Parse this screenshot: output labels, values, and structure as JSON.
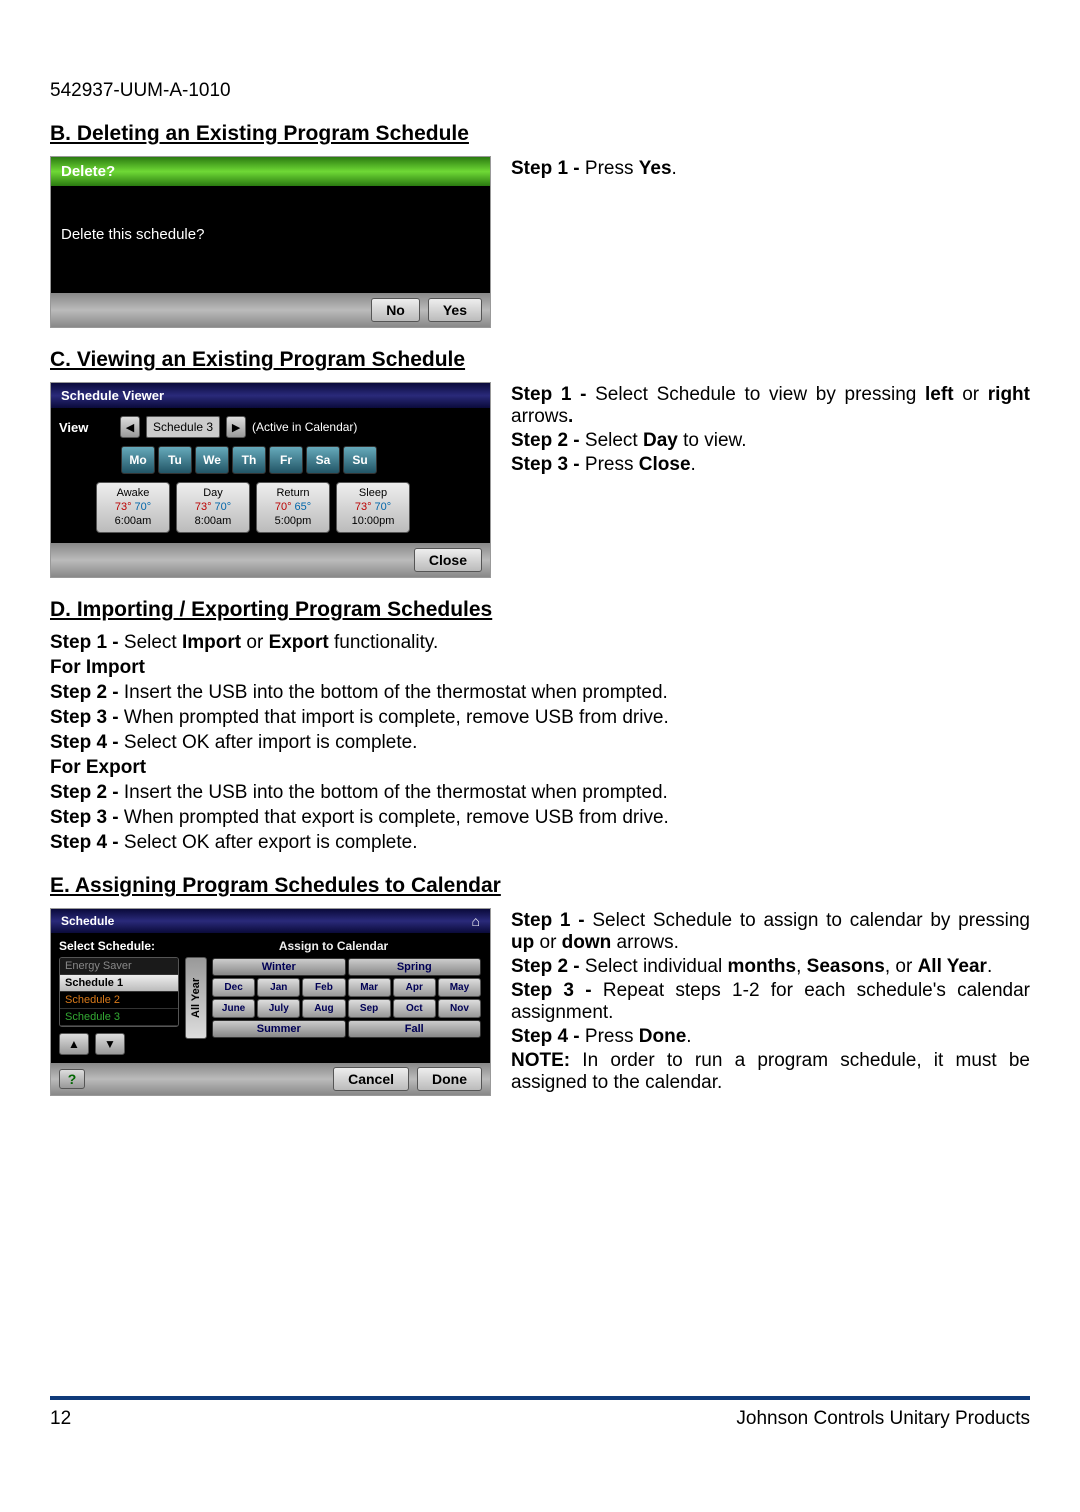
{
  "doc_id": "542937-UUM-A-1010",
  "sectionB": {
    "heading": "B. Deleting an Existing Program Schedule",
    "screen": {
      "title": "Delete?",
      "prompt": "Delete this schedule?",
      "no": "No",
      "yes": "Yes"
    },
    "step1_label": "Step 1 - ",
    "step1_text": "Press ",
    "step1_bold": "Yes",
    "step1_tail": "."
  },
  "sectionC": {
    "heading": "C. Viewing an Existing Program Schedule",
    "screen": {
      "title": "Schedule Viewer",
      "view": "View",
      "sched_name": "Schedule 3",
      "active": "(Active in Calendar)",
      "days": [
        "Mo",
        "Tu",
        "We",
        "Th",
        "Fr",
        "Sa",
        "Su"
      ],
      "periods": [
        {
          "name": "Awake",
          "h": "73°",
          "c": "70°",
          "time": "6:00am"
        },
        {
          "name": "Day",
          "h": "73°",
          "c": "70°",
          "time": "8:00am"
        },
        {
          "name": "Return",
          "h": "70°",
          "c": "65°",
          "time": "5:00pm"
        },
        {
          "name": "Sleep",
          "h": "73°",
          "c": "70°",
          "time": "10:00pm"
        }
      ],
      "close": "Close"
    },
    "step1a": "Step 1 - ",
    "step1b": "Select Schedule to view by pressing ",
    "step1c": "left",
    "step1d": " or ",
    "step1e": "right",
    "step1f": " arrows",
    "step1g": ".",
    "step2a": "Step 2 - ",
    "step2b": "Select ",
    "step2c": "Day",
    "step2d": " to view.",
    "step3a": "Step 3 - ",
    "step3b": "Press ",
    "step3c": "Close",
    "step3d": "."
  },
  "sectionD": {
    "heading": "D. Importing / Exporting Program Schedules",
    "s1a": "Step 1 - ",
    "s1b": "Select ",
    "s1c": "Import",
    "s1d": " or ",
    "s1e": "Export",
    "s1f": " functionality.",
    "imp": "For Import",
    "is2a": "Step 2 - ",
    "is2b": "Insert the USB into the bottom of the thermostat when prompted.",
    "is3a": "Step 3 - ",
    "is3b": "When prompted that import is complete, remove USB from drive.",
    "is4a": "Step 4 - ",
    "is4b": "Select OK after import is complete.",
    "exp": "For Export",
    "es2a": "Step 2 - ",
    "es2b": "Insert the USB into the bottom of the thermostat when prompted.",
    "es3a": "Step 3 - ",
    "es3b": "When prompted that export is complete, remove USB from drive.",
    "es4a": "Step 4 - ",
    "es4b": "Select OK after export is complete."
  },
  "sectionE": {
    "heading": "E. Assigning Program Schedules to Calendar",
    "screen": {
      "title": "Schedule",
      "select": "Select Schedule:",
      "items": [
        "Energy Saver",
        "Schedule 1",
        "Schedule 2",
        "Schedule 3"
      ],
      "assign": "Assign to Calendar",
      "allyear": "All Year",
      "winter": "Winter",
      "spring": "Spring",
      "summer": "Summer",
      "fall": "Fall",
      "months": [
        "Dec",
        "Jan",
        "Feb",
        "Mar",
        "Apr",
        "May",
        "June",
        "July",
        "Aug",
        "Sep",
        "Oct",
        "Nov"
      ],
      "cancel": "Cancel",
      "done": "Done",
      "help": "?"
    },
    "s1a": "Step 1 - ",
    "s1b": "Select Schedule to assign to calendar by pressing ",
    "s1c": "up",
    "s1d": " or ",
    "s1e": "down",
    "s1f": " arrows.",
    "s2a": "Step 2 - ",
    "s2b": "Select individual ",
    "s2c": "months",
    "s2d": ", ",
    "s2e": "Seasons",
    "s2f": ", or ",
    "s2g": "All Year",
    "s2h": ".",
    "s3a": "Step 3 - ",
    "s3b": "Repeat steps 1-2 for each schedule's calendar assignment.",
    "s4a": "Step 4 - ",
    "s4b": "Press ",
    "s4c": "Done",
    "s4d": ".",
    "notea": "NOTE:",
    "noteb": " In order to run a program schedule, it must be assigned to the calendar."
  },
  "footer": {
    "page": "12",
    "brand": "Johnson Controls Unitary Products"
  }
}
